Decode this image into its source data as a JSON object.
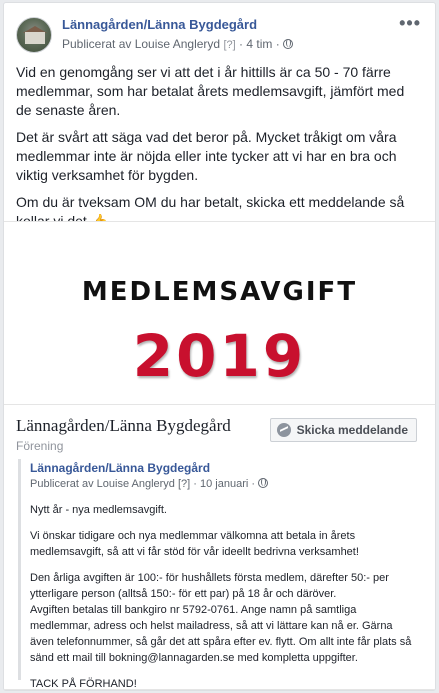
{
  "post": {
    "page_name": "Lännagården/Länna Bygdegård",
    "published_by": "Publicerat av Louise Angleryd",
    "q_mark": "[?]",
    "time": "4 tim",
    "more": "•••",
    "paragraphs": [
      "Vid en genomgång ser vi att det i år hittills är ca 50 - 70 färre medlemmar, som har betalat årets medlemsavgift, jämfört med de senaste åren.",
      "Det är svårt att säga vad det beror på. Mycket tråkigt om våra medlemmar inte är nöjda eller inte tycker att vi har en bra och viktig verksamhet för bygden.",
      "Om du är tveksam OM du har betalt, skicka ett meddelande så kollar vi det.👍"
    ]
  },
  "image": {
    "title": "MEDLEMSAVGIFT",
    "year": "2019"
  },
  "shared_page": {
    "name": "Lännagården/Länna Bygdegård",
    "category": "Förening",
    "send_message_label": "Skicka meddelande"
  },
  "quoted": {
    "page_name": "Lännagården/Länna Bygdegård",
    "published_by": "Publicerat av Louise Angleryd",
    "q_mark": "[?]",
    "time": "10 januari",
    "paragraphs": [
      "Nytt år - nya medlemsavgift.",
      "Vi önskar tidigare och nya medlemmar välkomna att betala in årets medlemsavgift, så att vi får stöd för vår ideellt bedrivna verksamhet!",
      "Den årliga avgiften är 100:- för hushållets första medlem, därefter 50:- per ytterligare person (alltså 150:- för ett par) på 18 år och däröver.\nAvgiften betalas till bankgiro nr 5792-0761. Ange namn på samtliga medlemmar, adress och helst mailadress, så att vi lättare kan nå er. Gärna även telefonnummer, så går det att spåra efter ev. flytt. Om allt inte får plats så sänd ett mail till bokning@lannagarden.se med kompletta uppgifter.",
      "TACK PÅ FÖRHAND!"
    ]
  },
  "colors": {
    "link": "#385898",
    "year_red": "#c8102e",
    "meta_gray": "#606770"
  }
}
